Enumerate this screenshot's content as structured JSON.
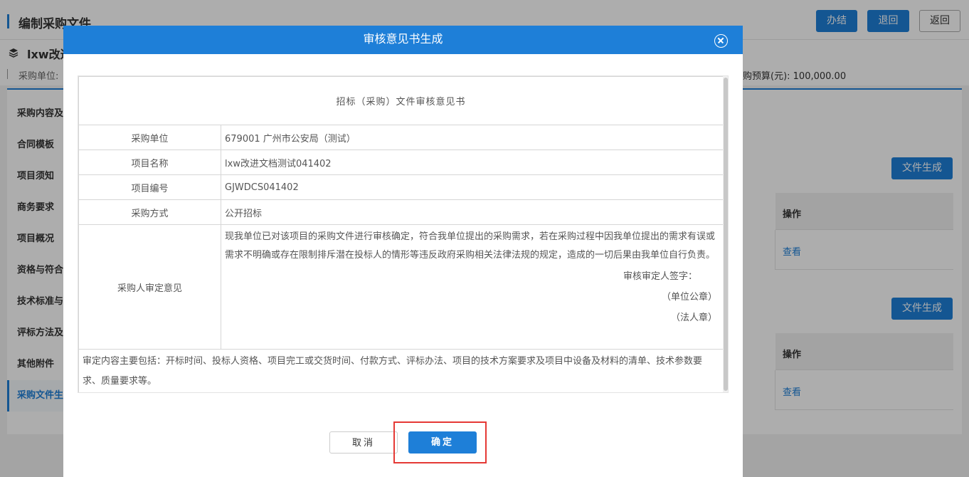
{
  "page": {
    "title": "编制采购文件",
    "buttons": {
      "finish": "办结",
      "return_back": "退回",
      "go_back": "返回"
    },
    "project_name": "lxw改进",
    "info_left": "采购单位:",
    "info_right": "购预算(元): 100,000.00",
    "sidebar": [
      {
        "label": "采购内容及"
      },
      {
        "label": "合同模板"
      },
      {
        "label": "项目须知"
      },
      {
        "label": "商务要求"
      },
      {
        "label": "项目概况"
      },
      {
        "label": "资格与符合"
      },
      {
        "label": "技术标准与"
      },
      {
        "label": "评标方法及"
      },
      {
        "label": "其他附件"
      },
      {
        "label": "采购文件生"
      }
    ],
    "sections": [
      {
        "generate_label": "文件生成",
        "op_header": "操作",
        "view_link": "查看"
      },
      {
        "generate_label": "文件生成",
        "op_header": "操作",
        "view_link": "查看"
      }
    ]
  },
  "modal": {
    "title": "审核意见书生成",
    "doc_title": "招标（采购）文件审核意见书",
    "rows": [
      {
        "label": "采购单位",
        "value": "679001 广州市公安局（测试）"
      },
      {
        "label": "项目名称",
        "value": "lxw改进文档测试041402"
      },
      {
        "label": "项目编号",
        "value": "GJWDCS041402"
      },
      {
        "label": "采购方式",
        "value": "公开招标"
      }
    ],
    "opinion_label": "采购人审定意见",
    "opinion_text": "现我单位已对该项目的采购文件进行审核确定，符合我单位提出的采购需求，若在采购过程中因我单位提出的需求有误或需求不明确或存在限制排斥潜在投标人的情形等违反政府采购相关法律法规的规定，造成的一切后果由我单位自行负责。",
    "signature": "审核审定人签字：",
    "unit_seal": "（单位公章）",
    "legal_seal": "（法人章）",
    "footer_text": "审定内容主要包括：开标时间、投标人资格、项目完工或交货时间、付款方式、评标办法、项目的技术方案要求及项目中设备及材料的清单、技术参数要求、质量要求等。",
    "cancel_label": "取消",
    "confirm_label": "确定"
  },
  "colors": {
    "accent": "#1e7fd8",
    "highlight_border": "#e53935"
  }
}
